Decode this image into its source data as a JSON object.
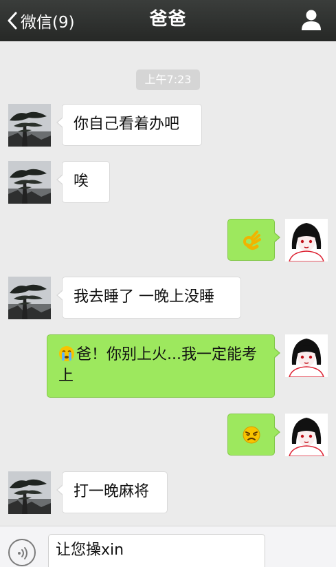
{
  "header": {
    "back_label": "微信(9)",
    "title": "爸爸"
  },
  "conversation": {
    "timestamp": "上午7:23",
    "messages": [
      {
        "from": "father",
        "text": "你自己看着办吧"
      },
      {
        "from": "father",
        "text": "唉"
      },
      {
        "from": "me",
        "emoji": "ok-hand"
      },
      {
        "from": "father",
        "text": "我去睡了 一晚上没睡"
      },
      {
        "from": "me",
        "emoji_prefix": "crying-face",
        "text": "爸！你别上火...我一定能考上"
      },
      {
        "from": "me",
        "emoji": "angry-face"
      },
      {
        "from": "father",
        "text": "打一晚麻将"
      }
    ]
  },
  "composer": {
    "draft": "让您操xin"
  },
  "colors": {
    "outgoing_bubble": "#9de85e",
    "incoming_bubble": "#ffffff",
    "background": "#ebebeb",
    "header": "#2f312f"
  }
}
